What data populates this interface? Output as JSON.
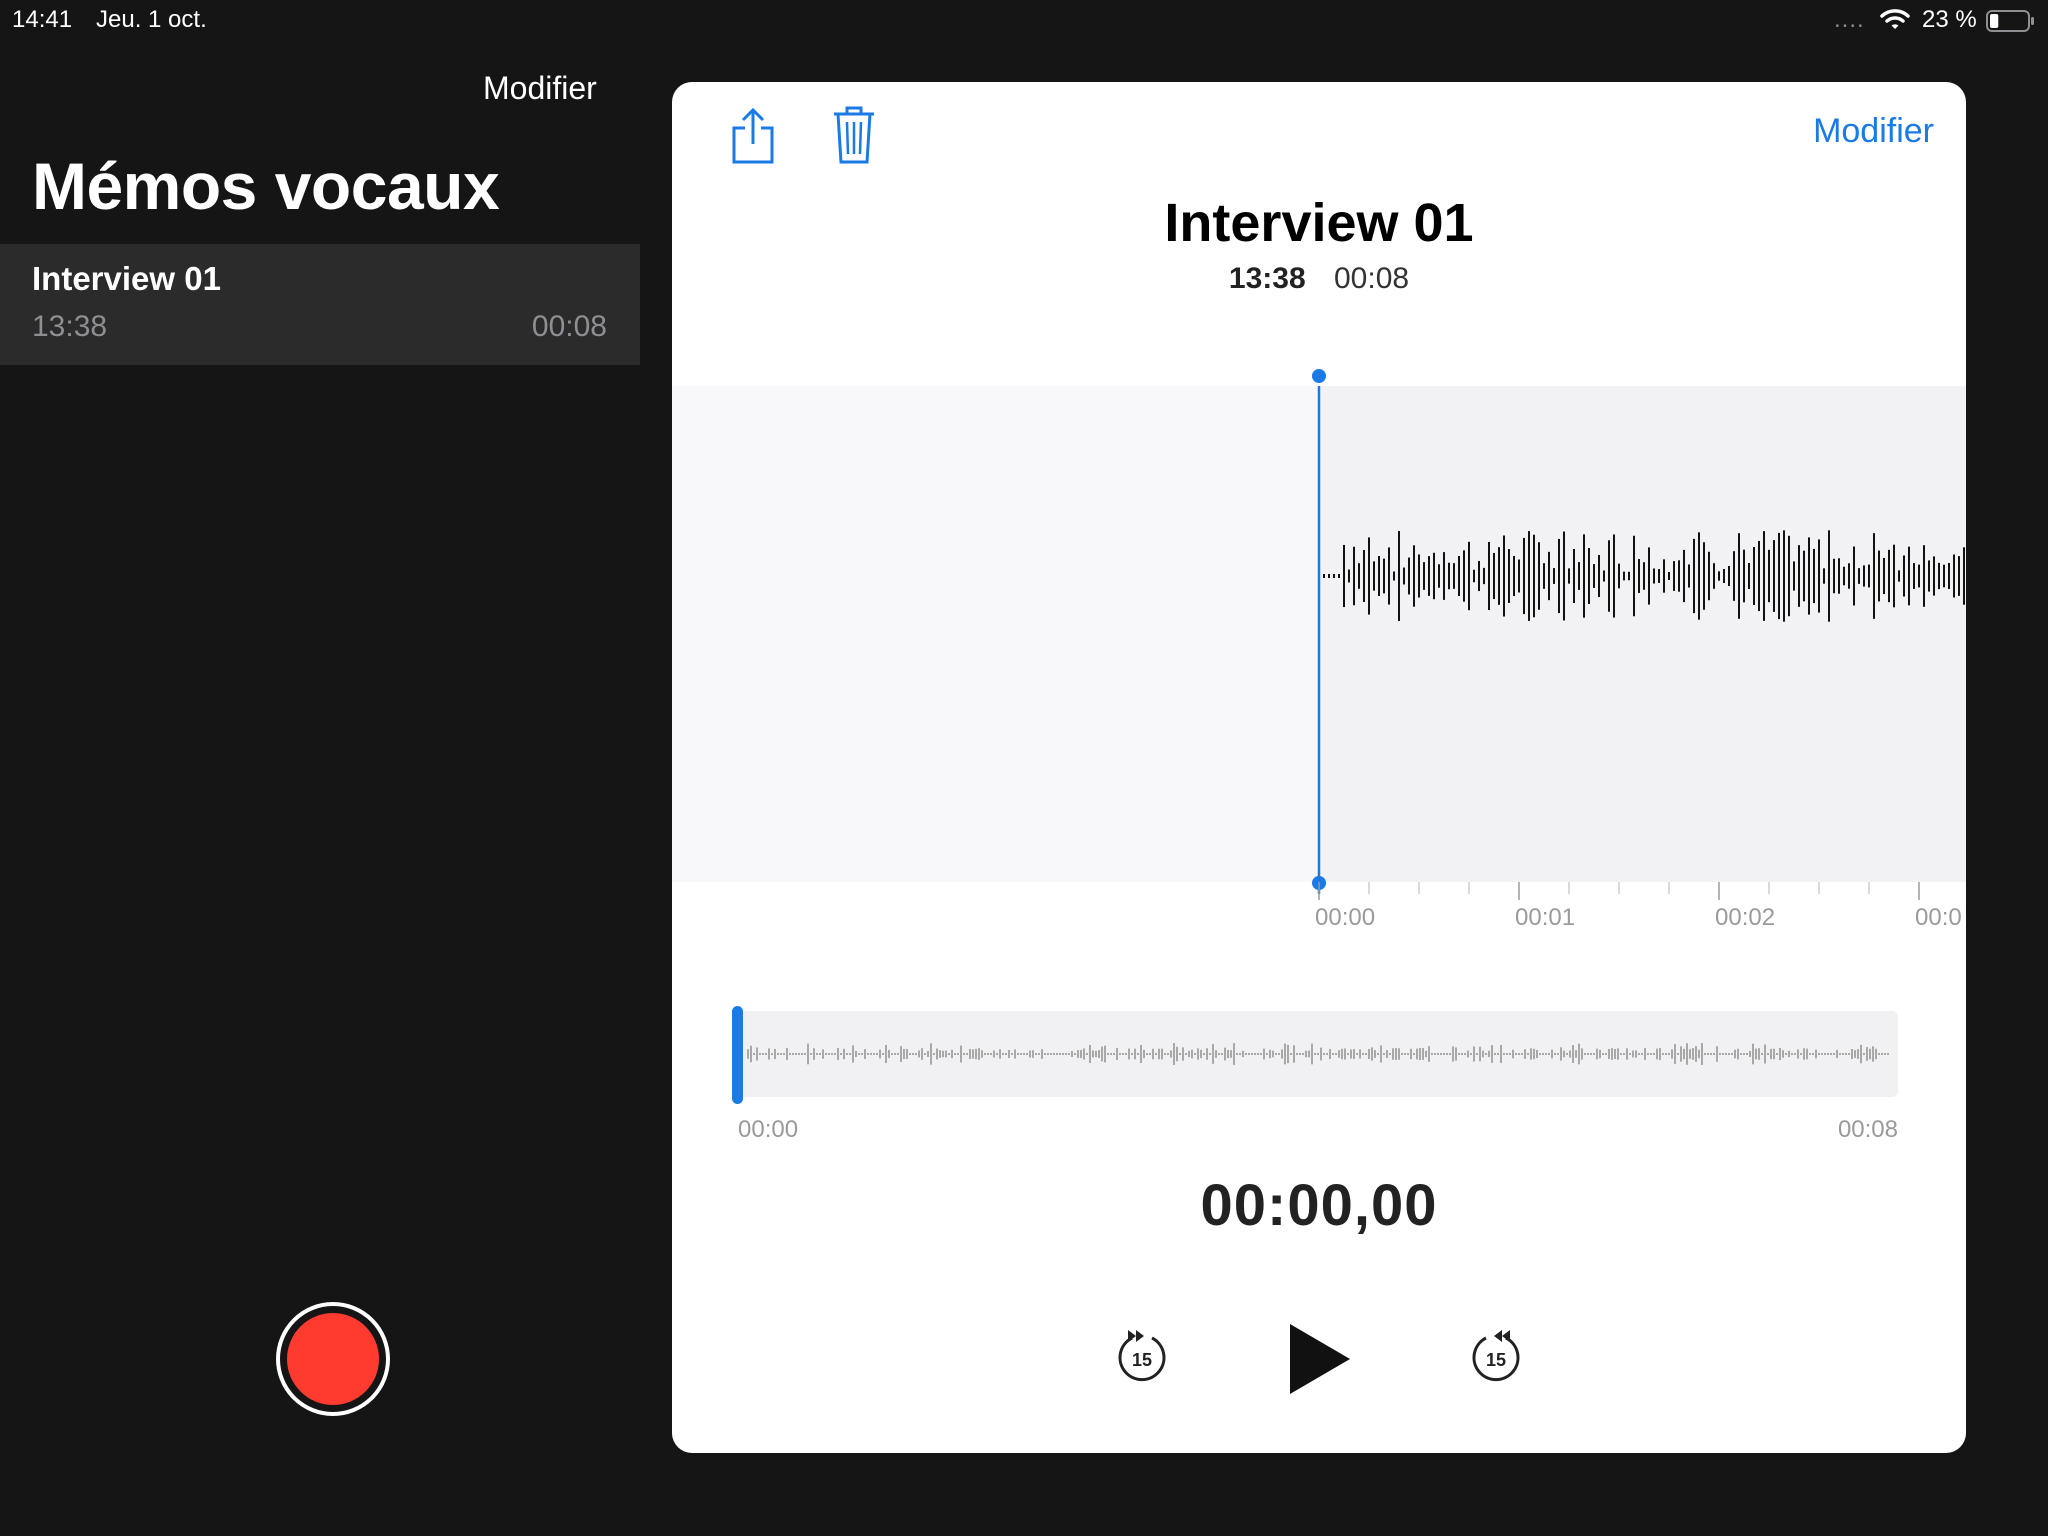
{
  "status_bar": {
    "time": "14:41",
    "date": "Jeu. 1 oct.",
    "signal": "....",
    "battery_percent": "23 %",
    "battery_level": 0.23
  },
  "sidebar": {
    "edit_label": "Modifier",
    "title": "Mémos vocaux",
    "items": [
      {
        "name": "Interview 01",
        "time": "13:38",
        "duration": "00:08"
      }
    ],
    "record_button": "record-icon",
    "accent_record": "#ff3b30"
  },
  "detail": {
    "share_icon": "share-icon",
    "trash_icon": "trash-icon",
    "edit_label": "Modifier",
    "title": "Interview 01",
    "time": "13:38",
    "duration": "00:08",
    "timeline_ticks": [
      "00:00",
      "00:01",
      "00:02",
      "00:0"
    ],
    "overview_start": "00:00",
    "overview_end": "00:08",
    "elapsed": "00:00,00",
    "skip_back_label": "15",
    "skip_forward_label": "15",
    "play_icon": "play-icon",
    "accent": "#1a7ae6",
    "playhead_position": 0.0
  }
}
